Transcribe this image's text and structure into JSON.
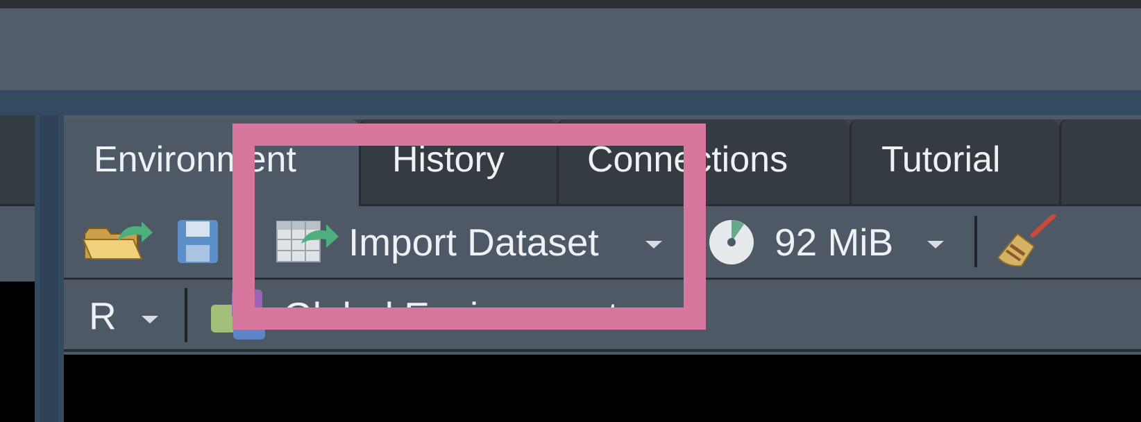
{
  "tabs": [
    {
      "label": "Environment",
      "active": true
    },
    {
      "label": "History",
      "active": false
    },
    {
      "label": "Connections",
      "active": false
    },
    {
      "label": "Tutorial",
      "active": false
    }
  ],
  "toolbar": {
    "load_workspace_icon": "open-folder-arrow-icon",
    "save_workspace_icon": "floppy-disk-icon",
    "import_dataset_label": "Import Dataset",
    "import_dataset_icon": "table-arrow-icon",
    "memory_usage_label": "92 MiB",
    "memory_usage_icon": "pie-chart-icon",
    "clear_workspace_icon": "broom-icon"
  },
  "toolbar2": {
    "language_label": "R",
    "environment_label": "Global Environment"
  },
  "colors": {
    "highlight": "#d8779e",
    "accent_arrow": "#4caf7d"
  }
}
